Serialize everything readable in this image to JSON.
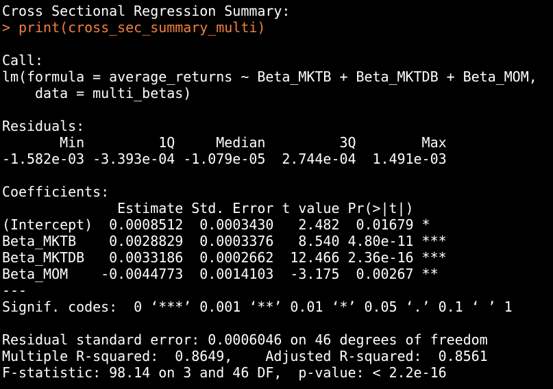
{
  "console": {
    "text_color": "#ffffff",
    "command_color": "#f0813d",
    "background_color": "#000000",
    "lines": [
      "Cross Sectional Regression Summary:",
      "> print(cross_sec_summary_multi)",
      "",
      "Call:",
      "lm(formula = average_returns ~ Beta_MKTB + Beta_MKTDB + Beta_MOM,",
      "    data = multi_betas)",
      "",
      "Residuals:",
      "       Min         1Q     Median         3Q        Max ",
      "-1.582e-03 -3.393e-04 -1.079e-05  2.744e-04  1.491e-03 ",
      "",
      "Coefficients:",
      "              Estimate Std. Error t value Pr(>|t|)    ",
      "(Intercept)  0.0008512  0.0003430   2.482  0.01679 *  ",
      "Beta_MKTB    0.0028829  0.0003376   8.540 4.80e-11 ***",
      "Beta_MKTDB   0.0033186  0.0002662  12.466 2.36e-16 ***",
      "Beta_MOM    -0.0044773  0.0014103  -3.175  0.00267 ** ",
      "---",
      "Signif. codes:  0 ‘***’ 0.001 ‘**’ 0.01 ‘*’ 0.05 ‘.’ 0.1 ‘ ’ 1",
      "",
      "Residual standard error: 0.0006046 on 46 degrees of freedom",
      "Multiple R-squared:  0.8649,\tAdjusted R-squared:  0.8561 ",
      "F-statistic: 98.14 on 3 and 46 DF,  p-value: < 2.2e-16"
    ]
  }
}
